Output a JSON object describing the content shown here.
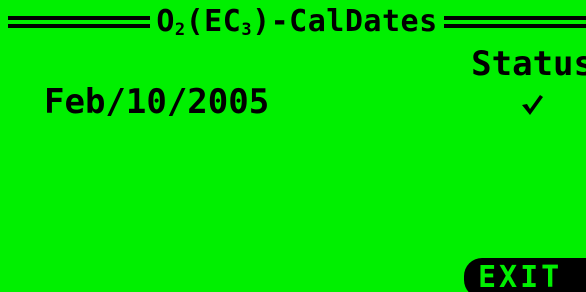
{
  "screen": {
    "title_prefix": "O",
    "title_sub1": "2",
    "title_mid": "(EC",
    "title_sub2": "3",
    "title_suffix": ")-CalDates",
    "status_header": "Status",
    "background_color": "#00f000"
  },
  "calibrations": [
    {
      "date": "Feb/10/2005",
      "status_icon": "checkmark-icon"
    }
  ],
  "softkeys": {
    "exit_label": "EXIT"
  }
}
